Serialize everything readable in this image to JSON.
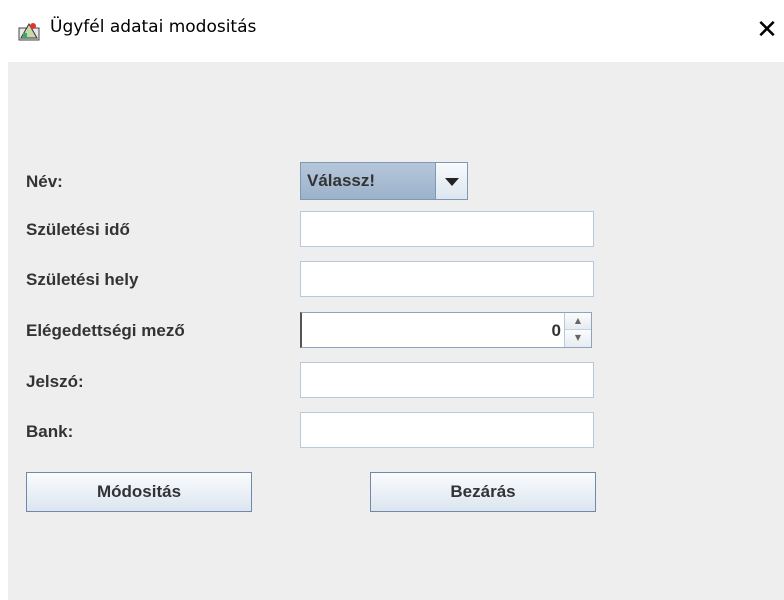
{
  "window": {
    "title": "Ügyfél adatai modositás",
    "close_glyph": "✕",
    "icon": "java-app-icon"
  },
  "form": {
    "nev_label": "Név:",
    "nev_combo_value": "Válassz!",
    "szuletesi_ido_label": "Születési idő",
    "szuletesi_ido_value": "",
    "szuletesi_hely_label": "Születési hely",
    "szuletesi_hely_value": "",
    "elegedettsegi_label": "Elégedettségi mező",
    "elegedettsegi_value": "0",
    "jelszo_label": "Jelszó:",
    "jelszo_value": "",
    "bank_label": "Bank:",
    "bank_value": ""
  },
  "buttons": {
    "modositas": "Módositás",
    "bezaras": "Bezárás"
  },
  "colors": {
    "panel": "#eeeeee",
    "combo_accent": "#a9bdd2",
    "field_border": "#b9c9dc"
  }
}
